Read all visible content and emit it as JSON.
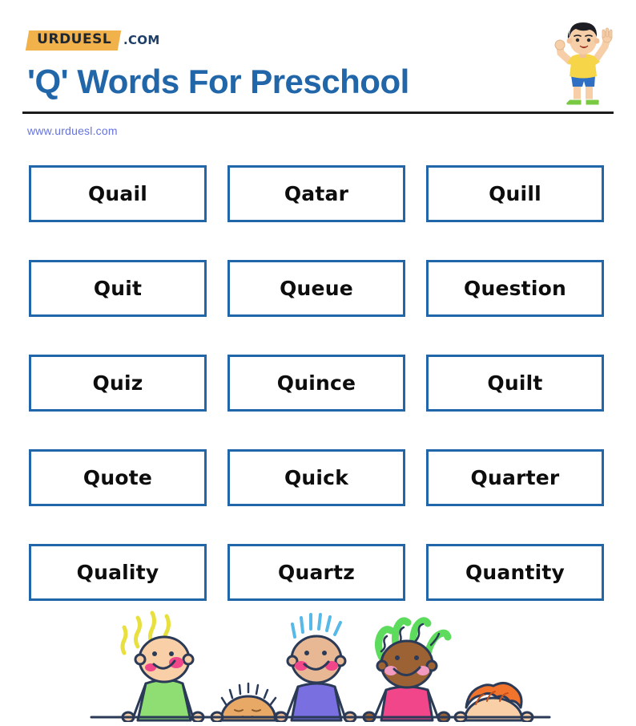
{
  "header": {
    "logo_name": "URDUESL",
    "logo_tld": ".COM",
    "title": "'Q' Words For Preschool",
    "site_url": "www.urduesl.com",
    "title_color": "#2166a8",
    "logo_banner_color": "#f2b24b",
    "url_color": "#6673dd"
  },
  "mascot": {
    "name": "cartoon-boy-cheering",
    "shirt_color": "#f7d548",
    "shorts_color": "#2f6fc4",
    "hair_color": "#1d1d24",
    "skin_color": "#f6cfa8",
    "shoe_color": "#7ac943"
  },
  "grid": {
    "box_border_color": "#2166a8",
    "box_fill_color": "#ffffff",
    "text_color": "#0d0d0d",
    "rows": [
      {
        "cells": [
          {
            "word": "Quail"
          },
          {
            "word": "Qatar"
          },
          {
            "word": "Quill"
          }
        ]
      },
      {
        "cells": [
          {
            "word": "Quit"
          },
          {
            "word": "Queue"
          },
          {
            "word": "Question"
          }
        ]
      },
      {
        "cells": [
          {
            "word": "Quiz"
          },
          {
            "word": "Quince"
          },
          {
            "word": "Quilt"
          }
        ]
      },
      {
        "cells": [
          {
            "word": "Quote"
          },
          {
            "word": "Quick"
          },
          {
            "word": "Quarter"
          }
        ]
      },
      {
        "cells": [
          {
            "word": "Quality"
          },
          {
            "word": "Quartz"
          },
          {
            "word": "Quantity"
          }
        ]
      }
    ]
  },
  "footer_art": {
    "name": "five-doodle-children",
    "children": [
      {
        "hair": "yellow-wavy",
        "hair_color": "#f2ea5a",
        "skin_color": "#f8cfa6",
        "shirt_color": "#8ede74"
      },
      {
        "hair": "orange-spiky-head",
        "hair_color": "#e8a866",
        "skin_color": "#e8a866",
        "shirt_color": ""
      },
      {
        "hair": "blue-spiky",
        "hair_color": "#57b9e8",
        "skin_color": "#e8b894",
        "shirt_color": "#7a6fe0"
      },
      {
        "hair": "green-curly",
        "hair_color": "#5ddb5d",
        "skin_color": "#9c6234",
        "shirt_color": "#f2468a"
      },
      {
        "hair": "orange-red-wavy",
        "hair_color": "#f2732c",
        "skin_color": "#f8cfa6",
        "shirt_color": ""
      }
    ],
    "outline_color": "#2b3a56"
  }
}
